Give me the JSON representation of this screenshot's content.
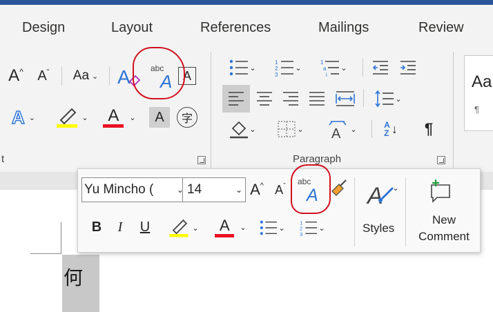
{
  "tabs": [
    "Design",
    "Layout",
    "References",
    "Mailings",
    "Review"
  ],
  "ribbon": {
    "font_group": {
      "grow_font": "A",
      "shrink_font": "A",
      "change_case": "Aa",
      "phonetic_guide": {
        "top": "abc",
        "bottom": "A"
      },
      "character_border": "A",
      "text_effects": "A",
      "font_color": "A",
      "character_shading": "A",
      "enclose_characters": "字",
      "label_fragment": "t"
    },
    "paragraph_group": {
      "label": "Paragraph",
      "sort": {
        "top": "A",
        "bottom": "Z"
      },
      "show_marks": "¶"
    },
    "styles_group": {
      "preview": "Aa",
      "preview_sub": "¶"
    }
  },
  "mini_toolbar": {
    "font_name": "Yu Mincho (",
    "font_size": "14",
    "grow_font": "A",
    "shrink_font": "A",
    "phonetic_guide": {
      "top": "abc",
      "bottom": "A"
    },
    "bold": "B",
    "italic": "I",
    "underline": "U",
    "font_color": "A",
    "styles_label": "Styles",
    "new_comment_line1": "New",
    "new_comment_line2": "Comment"
  },
  "document": {
    "selected_text": "何"
  },
  "colors": {
    "accent_blue": "#2b579a",
    "highlight_yellow": "#ffff00",
    "font_red": "#e81123",
    "annotation_red": "#d0101f",
    "icon_blue": "#2e75d6",
    "selection_gray": "#c8c8c8"
  }
}
